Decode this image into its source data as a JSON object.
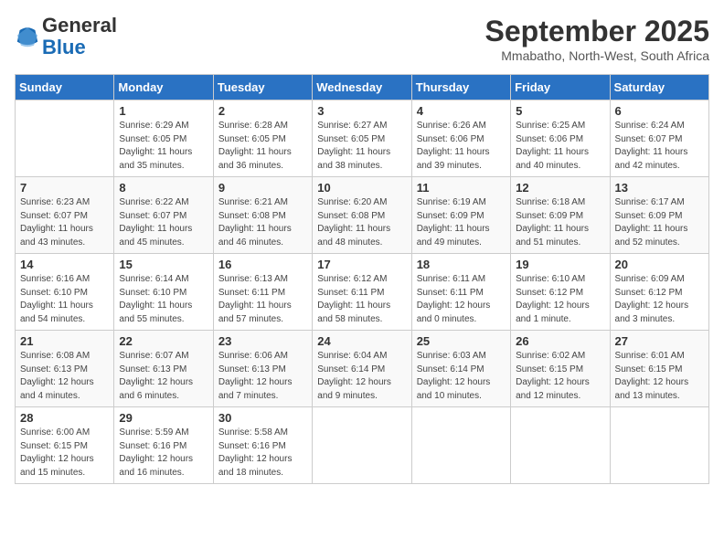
{
  "logo": {
    "line1": "General",
    "line2": "Blue"
  },
  "title": "September 2025",
  "subtitle": "Mmabatho, North-West, South Africa",
  "headers": [
    "Sunday",
    "Monday",
    "Tuesday",
    "Wednesday",
    "Thursday",
    "Friday",
    "Saturday"
  ],
  "weeks": [
    [
      {
        "day": "",
        "info": ""
      },
      {
        "day": "1",
        "info": "Sunrise: 6:29 AM\nSunset: 6:05 PM\nDaylight: 11 hours\nand 35 minutes."
      },
      {
        "day": "2",
        "info": "Sunrise: 6:28 AM\nSunset: 6:05 PM\nDaylight: 11 hours\nand 36 minutes."
      },
      {
        "day": "3",
        "info": "Sunrise: 6:27 AM\nSunset: 6:05 PM\nDaylight: 11 hours\nand 38 minutes."
      },
      {
        "day": "4",
        "info": "Sunrise: 6:26 AM\nSunset: 6:06 PM\nDaylight: 11 hours\nand 39 minutes."
      },
      {
        "day": "5",
        "info": "Sunrise: 6:25 AM\nSunset: 6:06 PM\nDaylight: 11 hours\nand 40 minutes."
      },
      {
        "day": "6",
        "info": "Sunrise: 6:24 AM\nSunset: 6:07 PM\nDaylight: 11 hours\nand 42 minutes."
      }
    ],
    [
      {
        "day": "7",
        "info": "Sunrise: 6:23 AM\nSunset: 6:07 PM\nDaylight: 11 hours\nand 43 minutes."
      },
      {
        "day": "8",
        "info": "Sunrise: 6:22 AM\nSunset: 6:07 PM\nDaylight: 11 hours\nand 45 minutes."
      },
      {
        "day": "9",
        "info": "Sunrise: 6:21 AM\nSunset: 6:08 PM\nDaylight: 11 hours\nand 46 minutes."
      },
      {
        "day": "10",
        "info": "Sunrise: 6:20 AM\nSunset: 6:08 PM\nDaylight: 11 hours\nand 48 minutes."
      },
      {
        "day": "11",
        "info": "Sunrise: 6:19 AM\nSunset: 6:09 PM\nDaylight: 11 hours\nand 49 minutes."
      },
      {
        "day": "12",
        "info": "Sunrise: 6:18 AM\nSunset: 6:09 PM\nDaylight: 11 hours\nand 51 minutes."
      },
      {
        "day": "13",
        "info": "Sunrise: 6:17 AM\nSunset: 6:09 PM\nDaylight: 11 hours\nand 52 minutes."
      }
    ],
    [
      {
        "day": "14",
        "info": "Sunrise: 6:16 AM\nSunset: 6:10 PM\nDaylight: 11 hours\nand 54 minutes."
      },
      {
        "day": "15",
        "info": "Sunrise: 6:14 AM\nSunset: 6:10 PM\nDaylight: 11 hours\nand 55 minutes."
      },
      {
        "day": "16",
        "info": "Sunrise: 6:13 AM\nSunset: 6:11 PM\nDaylight: 11 hours\nand 57 minutes."
      },
      {
        "day": "17",
        "info": "Sunrise: 6:12 AM\nSunset: 6:11 PM\nDaylight: 11 hours\nand 58 minutes."
      },
      {
        "day": "18",
        "info": "Sunrise: 6:11 AM\nSunset: 6:11 PM\nDaylight: 12 hours\nand 0 minutes."
      },
      {
        "day": "19",
        "info": "Sunrise: 6:10 AM\nSunset: 6:12 PM\nDaylight: 12 hours\nand 1 minute."
      },
      {
        "day": "20",
        "info": "Sunrise: 6:09 AM\nSunset: 6:12 PM\nDaylight: 12 hours\nand 3 minutes."
      }
    ],
    [
      {
        "day": "21",
        "info": "Sunrise: 6:08 AM\nSunset: 6:13 PM\nDaylight: 12 hours\nand 4 minutes."
      },
      {
        "day": "22",
        "info": "Sunrise: 6:07 AM\nSunset: 6:13 PM\nDaylight: 12 hours\nand 6 minutes."
      },
      {
        "day": "23",
        "info": "Sunrise: 6:06 AM\nSunset: 6:13 PM\nDaylight: 12 hours\nand 7 minutes."
      },
      {
        "day": "24",
        "info": "Sunrise: 6:04 AM\nSunset: 6:14 PM\nDaylight: 12 hours\nand 9 minutes."
      },
      {
        "day": "25",
        "info": "Sunrise: 6:03 AM\nSunset: 6:14 PM\nDaylight: 12 hours\nand 10 minutes."
      },
      {
        "day": "26",
        "info": "Sunrise: 6:02 AM\nSunset: 6:15 PM\nDaylight: 12 hours\nand 12 minutes."
      },
      {
        "day": "27",
        "info": "Sunrise: 6:01 AM\nSunset: 6:15 PM\nDaylight: 12 hours\nand 13 minutes."
      }
    ],
    [
      {
        "day": "28",
        "info": "Sunrise: 6:00 AM\nSunset: 6:15 PM\nDaylight: 12 hours\nand 15 minutes."
      },
      {
        "day": "29",
        "info": "Sunrise: 5:59 AM\nSunset: 6:16 PM\nDaylight: 12 hours\nand 16 minutes."
      },
      {
        "day": "30",
        "info": "Sunrise: 5:58 AM\nSunset: 6:16 PM\nDaylight: 12 hours\nand 18 minutes."
      },
      {
        "day": "",
        "info": ""
      },
      {
        "day": "",
        "info": ""
      },
      {
        "day": "",
        "info": ""
      },
      {
        "day": "",
        "info": ""
      }
    ]
  ]
}
